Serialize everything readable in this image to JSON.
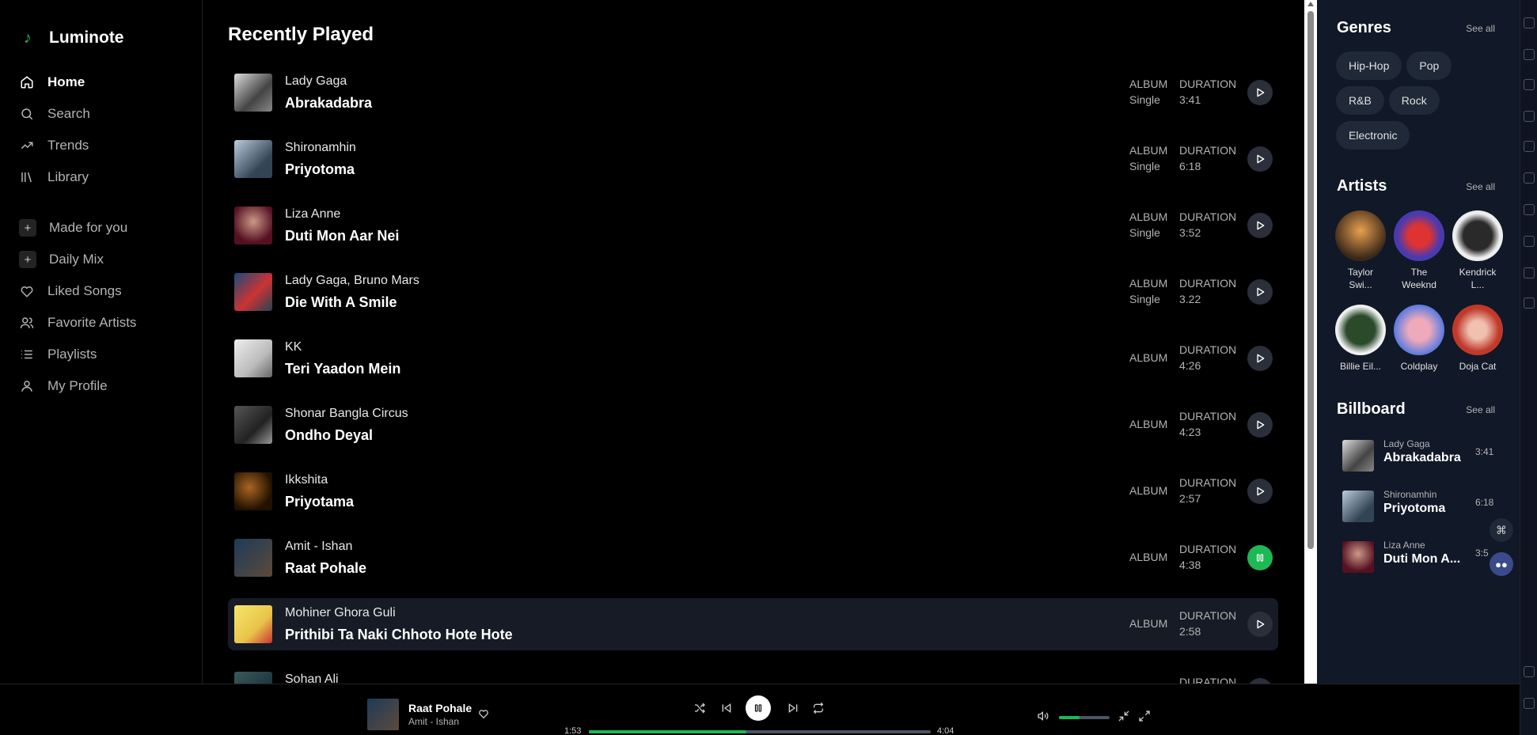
{
  "app": {
    "name": "Luminote"
  },
  "colors": {
    "accent": "#1db954",
    "panel": "#111827",
    "highlight_row": "#161b26"
  },
  "nav": [
    {
      "label": "Home",
      "icon": "home-icon",
      "active": true
    },
    {
      "label": "Search",
      "icon": "search-icon"
    },
    {
      "label": "Trends",
      "icon": "trend-icon"
    },
    {
      "label": "Library",
      "icon": "library-icon"
    }
  ],
  "nav2": [
    {
      "label": "Made for you",
      "icon": "plus-box-icon"
    },
    {
      "label": "Daily Mix",
      "icon": "plus-box-icon"
    },
    {
      "label": "Liked Songs",
      "icon": "heart-icon"
    },
    {
      "label": "Favorite Artists",
      "icon": "users-icon"
    },
    {
      "label": "Playlists",
      "icon": "list-icon"
    },
    {
      "label": "My Profile",
      "icon": "user-icon"
    }
  ],
  "main": {
    "title": "Recently Played",
    "album_label": "ALBUM",
    "duration_label": "DURATION",
    "tracks": [
      {
        "artist": "Lady Gaga",
        "title": "Abrakadabra",
        "album": "Single",
        "duration": "3:41"
      },
      {
        "artist": "Shironamhin",
        "title": "Priyotoma",
        "album": "Single",
        "duration": "6:18"
      },
      {
        "artist": "Liza Anne",
        "title": "Duti Mon Aar Nei",
        "album": "Single",
        "duration": "3:52"
      },
      {
        "artist": "Lady Gaga, Bruno Mars",
        "title": "Die With A Smile",
        "album": "Single",
        "duration": "3.22"
      },
      {
        "artist": "KK",
        "title": "Teri Yaadon Mein",
        "album": "",
        "duration": "4:26"
      },
      {
        "artist": "Shonar Bangla Circus",
        "title": "Ondho Deyal",
        "album": "",
        "duration": "4:23"
      },
      {
        "artist": "Ikkshita",
        "title": "Priyotama",
        "album": "",
        "duration": "2:57"
      },
      {
        "artist": "Amit - Ishan",
        "title": "Raat Pohale",
        "album": "",
        "duration": "4:38",
        "playing": true
      },
      {
        "artist": "Mohiner Ghora Guli",
        "title": "Prithibi Ta Naki Chhoto Hote Hote",
        "album": "",
        "duration": "2:58",
        "highlighted": true
      },
      {
        "artist": "Sohan Ali",
        "title": "",
        "album": "",
        "duration": ""
      }
    ]
  },
  "right": {
    "genres": {
      "title": "Genres",
      "see_all": "See all",
      "items": [
        "Hip-Hop",
        "Pop",
        "R&B",
        "Rock",
        "Electronic"
      ]
    },
    "artists": {
      "title": "Artists",
      "see_all": "See all",
      "items": [
        {
          "line1": "Taylor",
          "line2": "Swi..."
        },
        {
          "line1": "The",
          "line2": "Weeknd"
        },
        {
          "line1": "Kendrick",
          "line2": "L..."
        },
        {
          "line1": "Billie Eil...",
          "line2": ""
        },
        {
          "line1": "Coldplay",
          "line2": ""
        },
        {
          "line1": "Doja Cat",
          "line2": ""
        }
      ]
    },
    "billboard": {
      "title": "Billboard",
      "see_all": "See all",
      "items": [
        {
          "artist": "Lady Gaga",
          "title": "Abrakadabra",
          "duration": "3:41"
        },
        {
          "artist": "Shironamhin",
          "title": "Priyotoma",
          "duration": "6:18"
        },
        {
          "artist": "Liza Anne",
          "title": "Duti Mon A...",
          "duration": "3:5"
        }
      ]
    }
  },
  "player": {
    "title": "Raat Pohale",
    "artist": "Amit - Ishan",
    "elapsed": "1:53",
    "total": "4:04",
    "progress": 0.46,
    "volume": 0.4
  }
}
